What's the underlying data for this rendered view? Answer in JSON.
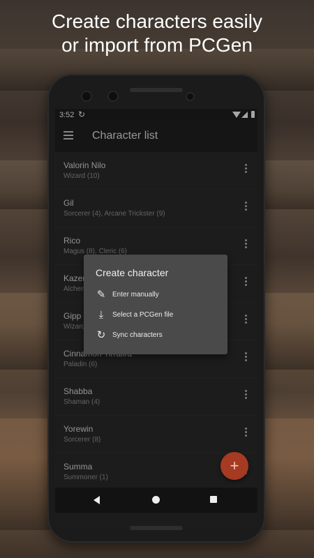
{
  "headline": {
    "line1": "Create characters easily",
    "line2": "or import from PCGen"
  },
  "status_bar": {
    "time": "3:52",
    "icons": [
      "sync-status-icon",
      "wifi-icon",
      "signal-icon",
      "battery-icon"
    ]
  },
  "app_bar": {
    "title": "Character list",
    "menu_icon": "hamburger-menu-icon"
  },
  "characters": [
    {
      "name": "Valorin Nilo",
      "classes": "Wizard (10)"
    },
    {
      "name": "Gil",
      "classes": "Sorcerer (4), Arcane Trickster (9)"
    },
    {
      "name": "Rico",
      "classes": "Magus (8), Cleric (6)"
    },
    {
      "name": "Kazer",
      "classes": "Alchemist (7)"
    },
    {
      "name": "Gipp",
      "classes": "Wizard (5)"
    },
    {
      "name": "Cinnamon Tirralira",
      "classes": "Paladin (6)"
    },
    {
      "name": "Shabba",
      "classes": "Shaman (4)"
    },
    {
      "name": "Yorewin",
      "classes": "Sorcerer (8)"
    },
    {
      "name": "Summa",
      "classes": "Summoner (1)"
    }
  ],
  "dialog": {
    "title": "Create character",
    "options": [
      {
        "label": "Enter manually",
        "icon": "pencil-icon"
      },
      {
        "label": "Select a PCGen file",
        "icon": "download-icon"
      },
      {
        "label": "Sync characters",
        "icon": "sync-icon"
      }
    ]
  },
  "fab": {
    "label": "+",
    "icon": "add-icon"
  },
  "colors": {
    "accent": "#a63a22",
    "dialog_bg": "#4a4a4a",
    "list_bg": "#2b2b2b"
  }
}
